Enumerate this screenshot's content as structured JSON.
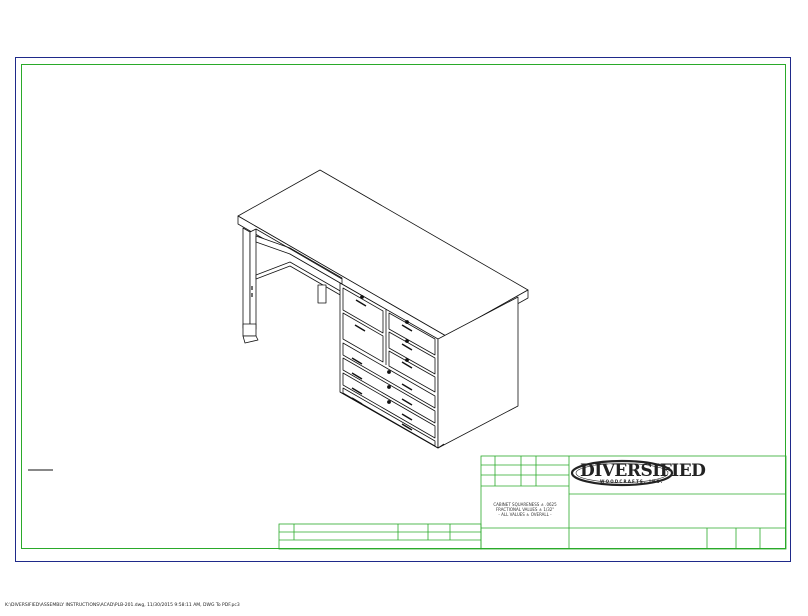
{
  "title_block": {
    "company_name": "DIVERSIFIED",
    "company_sub": "WOODCRAFTS, INC.",
    "notes": [
      "CABINET SQUARENESS ± .0625",
      "FRACTIONAL VALUES ± 1/32\"",
      "- ALL VALUES ± OVERALL -"
    ]
  },
  "footer": {
    "file_path": "K:\\DIVERSIFIED\\ASSEMBLY INSTRUCTIONS\\ACAD\\PLB-201.dwg, 11/30/2015 9:58:11 AM, DWG To PDF.pc3"
  },
  "colors": {
    "outer_border": "#1f2a8a",
    "inner_border": "#2aaa2a",
    "line_work": "#111111"
  }
}
